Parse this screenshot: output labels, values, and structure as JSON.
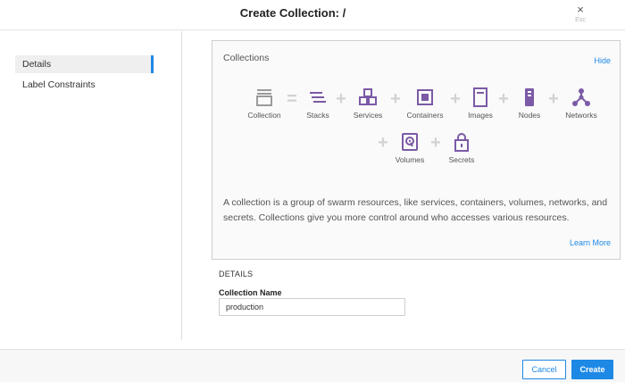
{
  "dialog": {
    "title": "Create Collection: /",
    "close_glyph": "×",
    "esc_label": "Esc"
  },
  "sidebar": {
    "items": [
      {
        "label": "Details",
        "active": true
      },
      {
        "label": "Label Constraints",
        "active": false
      }
    ]
  },
  "info_panel": {
    "title": "Collections",
    "hide_label": "Hide",
    "equals_glyph": "=",
    "plus_glyph": "+",
    "resources": [
      {
        "label": "Collection",
        "icon": "collection-icon"
      },
      {
        "label": "Stacks",
        "icon": "stacks-icon"
      },
      {
        "label": "Services",
        "icon": "services-icon"
      },
      {
        "label": "Containers",
        "icon": "containers-icon"
      },
      {
        "label": "Images",
        "icon": "images-icon"
      },
      {
        "label": "Nodes",
        "icon": "nodes-icon"
      },
      {
        "label": "Networks",
        "icon": "networks-icon"
      },
      {
        "label": "Volumes",
        "icon": "volumes-icon"
      },
      {
        "label": "Secrets",
        "icon": "secrets-icon"
      }
    ],
    "description": "A collection is a group of swarm resources, like services, containers, volumes, networks, and secrets. Collections give you more control around who accesses various resources.",
    "learn_more_label": "Learn More"
  },
  "details": {
    "section_label": "DETAILS",
    "collection_name_label": "Collection Name",
    "collection_name_value": "production"
  },
  "footer": {
    "cancel_label": "Cancel",
    "create_label": "Create"
  },
  "colors": {
    "accent": "#1e88e5",
    "icon_purple": "#7b5aa6",
    "icon_gray": "#9b9b9b"
  }
}
